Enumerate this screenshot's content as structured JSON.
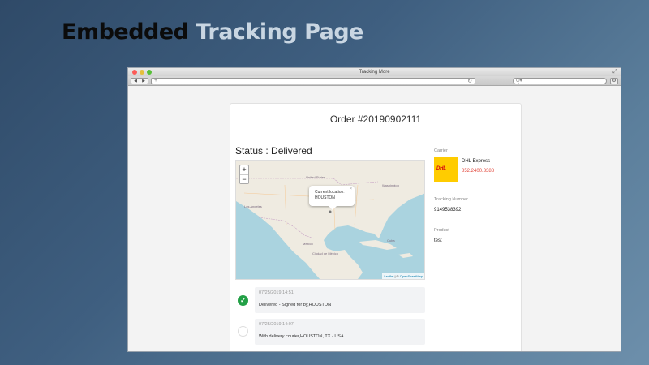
{
  "headline": {
    "word1": "Embedded",
    "word2": "Tracking Page"
  },
  "browser": {
    "title": "Tracking More",
    "nav_back": "◀",
    "nav_forward": "▶",
    "address_plus": "+",
    "reload_icon": "↻",
    "search_icon": "Q▾",
    "settings_icon": "⚙",
    "resize_icon": "⤢"
  },
  "order": {
    "title": "Order #20190902111"
  },
  "status": {
    "text": "Status : Delivered"
  },
  "map": {
    "zoom_in": "+",
    "zoom_out": "−",
    "popup_line1": "Current location:",
    "popup_line2": "HOUSTON",
    "popup_close": "×",
    "labels": {
      "usa": "United States",
      "la": "Los Angeles",
      "mexico": "México",
      "cdmx": "Ciudad de México",
      "washington": "Washington",
      "havana": "Cuba"
    },
    "attribution_leaflet": "Leaflet",
    "attribution_sep": " | © ",
    "attribution_osm": "OpenStreetMap"
  },
  "events": [
    {
      "time": "07/25/2019 14:51",
      "description": "Delivered - Signed for by,HOUSTON",
      "status": "done"
    },
    {
      "time": "07/25/2019 14:07",
      "description": "With delivery courier,HOUSTON, TX - USA",
      "status": "pending"
    }
  ],
  "carrier": {
    "label": "Carrier",
    "logo_text": "DHL",
    "name": "DHL Express",
    "phone": "852.2400.3388"
  },
  "tracking": {
    "label": "Tracking Number",
    "value": "9149538392"
  },
  "product": {
    "label": "Product",
    "value": "test"
  },
  "colors": {
    "delivered": "#22a046",
    "phone": "#e2463b",
    "dhl_yellow": "#ffcc00",
    "dhl_red": "#d40511"
  }
}
